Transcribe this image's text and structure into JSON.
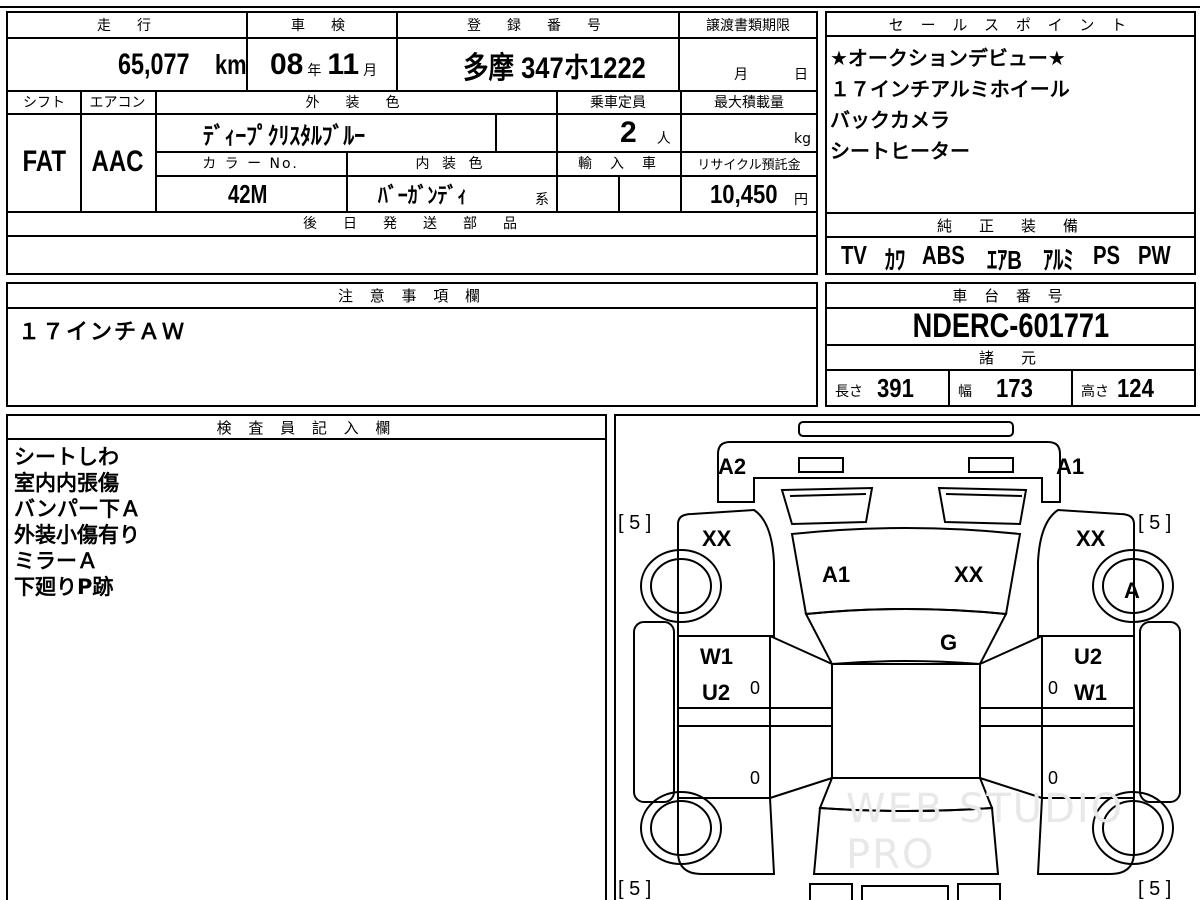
{
  "vehicle": {
    "mileage_label": "走　行",
    "mileage_value": "65,077",
    "mileage_unit": "km",
    "inspection_label": "車　検",
    "inspection_year": "08",
    "inspection_year_unit": "年",
    "inspection_month": "11",
    "inspection_month_unit": "月",
    "registration_label": "登　録　番　号",
    "registration_value": "多摩 347ホ1222",
    "transfer_label": "譲渡書類期限",
    "transfer_month_unit": "月",
    "transfer_day_unit": "日",
    "shift_label": "シフト",
    "shift_value": "FAT",
    "aircon_label": "エアコン",
    "aircon_value": "AAC",
    "exterior_label": "外　装　色",
    "exterior_value": "ﾃﾞｨｰﾌﾟｸﾘｽﾀﾙﾌﾞﾙｰ",
    "capacity_label": "乗車定員",
    "capacity_value": "2",
    "capacity_unit": "人",
    "max_load_label": "最大積載量",
    "max_load_unit": "kg",
    "color_no_label": "カ ラ ー No.",
    "color_no_value": "42M",
    "interior_label": "内 装 色",
    "interior_value": "ﾊﾞｰｶﾞﾝﾃﾞｨ",
    "interior_suffix": "系",
    "import_label": "輸　入　車",
    "recycle_label": "リサイクル預託金",
    "recycle_value": "10,450",
    "recycle_unit": "円",
    "later_parts_label": "後　日　発　送　部　品"
  },
  "sales_points": {
    "title": "セ ー ル ス ポ イ ン ト",
    "lines": [
      "★オークションデビュー★",
      "１７インチアルミホイール",
      "バックカメラ",
      "シートヒーター"
    ]
  },
  "equipment": {
    "title": "純　正　装　備",
    "items": [
      "TV",
      "ｶﾜ",
      "ABS",
      "ｴｱB",
      "ｱﾙﾐ",
      "PS",
      "PW"
    ]
  },
  "notes": {
    "title": "注 意 事 項 欄",
    "text": "１７インチＡＷ"
  },
  "chassis": {
    "title": "車 台 番 号",
    "value": "NDERC-601771"
  },
  "specs": {
    "title": "諸　元",
    "length_label": "長さ",
    "length_value": "391",
    "width_label": "幅",
    "width_value": "173",
    "height_label": "高さ",
    "height_value": "124"
  },
  "inspector": {
    "title": "検 査 員 記 入 欄",
    "lines": [
      "シートしわ",
      "室内内張傷",
      "バンパー下Ａ",
      "外装小傷有り",
      "ミラーＡ",
      "下廻りP跡"
    ]
  },
  "diagram": {
    "marks": {
      "a2": "A2",
      "a1_top": "A1",
      "bracket_tl": "[ 5 ]",
      "bracket_tr": "[ 5 ]",
      "bracket_bl": "[ 5 ]",
      "bracket_br": "[ 5 ]",
      "xx_left": "XX",
      "xx_right": "XX",
      "a1_hood": "A1",
      "xx_hood": "XX",
      "a_wheel": "A",
      "g_glass": "G",
      "w1_left": "W1",
      "u2_left": "U2",
      "u2_right": "U2",
      "w1_right": "W1",
      "zero_1": "0",
      "zero_2": "0",
      "zero_3": "0",
      "zero_4": "0"
    },
    "watermark": "WEB STUDIO PRO"
  }
}
